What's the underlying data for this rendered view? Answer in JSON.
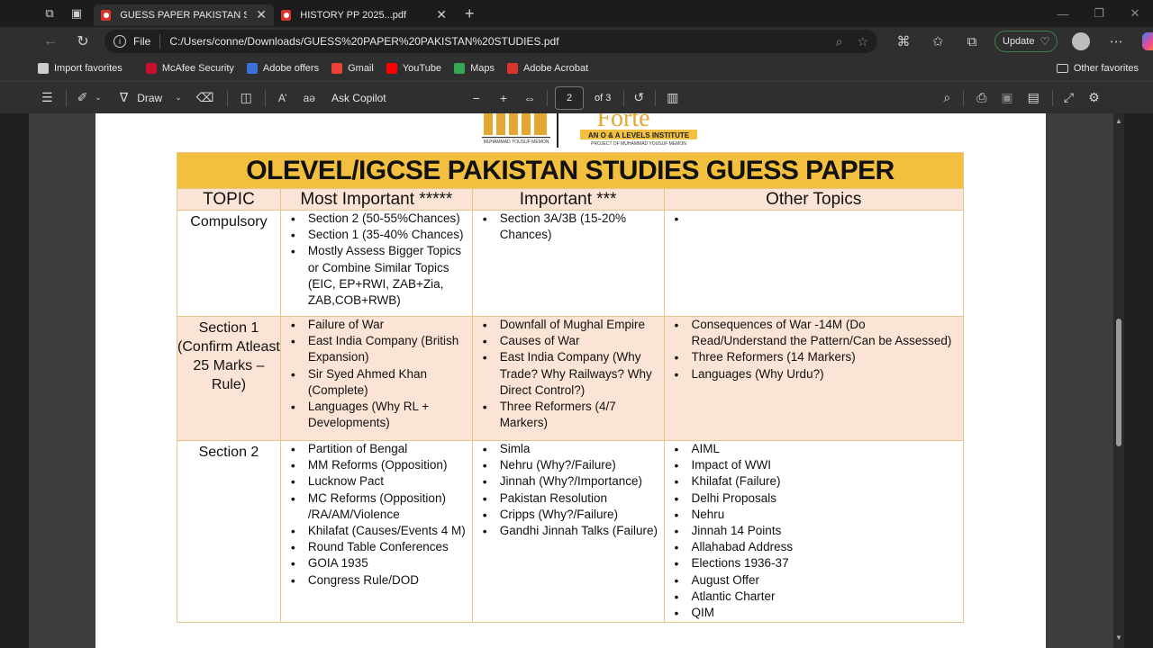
{
  "browser": {
    "tabs": [
      {
        "label": "GUESS PAPER PAKISTAN STUDIES",
        "active": true
      },
      {
        "label": "HISTORY PP 2025...pdf",
        "active": false
      }
    ],
    "address": {
      "scheme": "File",
      "url": "C:/Users/conne/Downloads/GUESS%20PAPER%20PAKISTAN%20STUDIES.pdf"
    },
    "update_label": "Update",
    "favorites": [
      {
        "label": "Import favorites",
        "icon": "import-icon",
        "color": "#cfcfcf"
      },
      {
        "label": "McAfee Security",
        "icon": "mcafee-icon",
        "color": "#c8102e"
      },
      {
        "label": "Adobe offers",
        "icon": "adobe-icon",
        "color": "#3b6fd8"
      },
      {
        "label": "Gmail",
        "icon": "gmail-icon",
        "color": "#ea4335"
      },
      {
        "label": "YouTube",
        "icon": "youtube-icon",
        "color": "#ff0000"
      },
      {
        "label": "Maps",
        "icon": "maps-icon",
        "color": "#34a853"
      },
      {
        "label": "Adobe Acrobat",
        "icon": "acrobat-icon",
        "color": "#d9342b"
      }
    ],
    "other_favorites": "Other favorites"
  },
  "pdf_toolbar": {
    "draw_label": "Draw",
    "copilot_label": "Ask Copilot",
    "page_current": "2",
    "page_total": "of 3"
  },
  "document": {
    "logo_left_text": "MUHAMMAD YOUSUF MEMON",
    "logo_right_text": "Forte",
    "logo_right_sub": "AN O & A LEVELS INSTITUTE",
    "logo_right_sub2": "PROJECT OF MUHAMMAD YOUSUF MEMON",
    "title": "OLEVEL/IGCSE PAKISTAN STUDIES GUESS PAPER",
    "headers": [
      "TOPIC",
      "Most Important *****",
      "Important ***",
      "Other Topics"
    ],
    "rows": [
      {
        "topic": "Compulsory",
        "most": [
          "Section 2 (50-55%Chances)",
          "Section 1 (35-40% Chances)",
          "Mostly Assess Bigger Topics or Combine Similar Topics (EIC, EP+RWI, ZAB+Zia, ZAB,COB+RWB)"
        ],
        "important": [
          "Section 3A/3B (15-20% Chances)"
        ],
        "other": [
          ""
        ]
      },
      {
        "topic": "Section 1 (Confirm Atleast 25 Marks – Rule)",
        "most": [
          "Failure of War",
          "East India Company (British Expansion)",
          "Sir Syed Ahmed Khan (Complete)",
          "Languages (Why RL + Developments)"
        ],
        "important": [
          "Downfall of Mughal Empire",
          "Causes of War",
          "East India Company (Why Trade? Why Railways? Why Direct Control?)",
          "Three Reformers (4/7 Markers)"
        ],
        "other": [
          "Consequences of War -14M (Do Read/Understand the Pattern/Can be Assessed)",
          "Three Reformers (14 Markers)",
          "Languages (Why Urdu?)"
        ]
      },
      {
        "topic": "Section 2",
        "most": [
          "Partition of Bengal",
          "MM Reforms (Opposition)",
          "Lucknow Pact",
          "MC Reforms (Opposition) /RA/AM/Violence",
          "Khilafat (Causes/Events 4 M)",
          "Round Table Conferences",
          "GOIA 1935",
          "Congress Rule/DOD"
        ],
        "important": [
          "Simla",
          "Nehru (Why?/Failure)",
          "Jinnah (Why?/Importance)",
          "Pakistan Resolution",
          "Cripps (Why?/Failure)",
          "Gandhi Jinnah Talks (Failure)"
        ],
        "other": [
          "AIML",
          "Impact of WWI",
          "Khilafat (Failure)",
          "Delhi Proposals",
          "Nehru",
          "Jinnah 14 Points",
          "Allahabad Address",
          "Elections 1936-37",
          "August Offer",
          "Atlantic Charter",
          "QIM"
        ]
      }
    ]
  }
}
